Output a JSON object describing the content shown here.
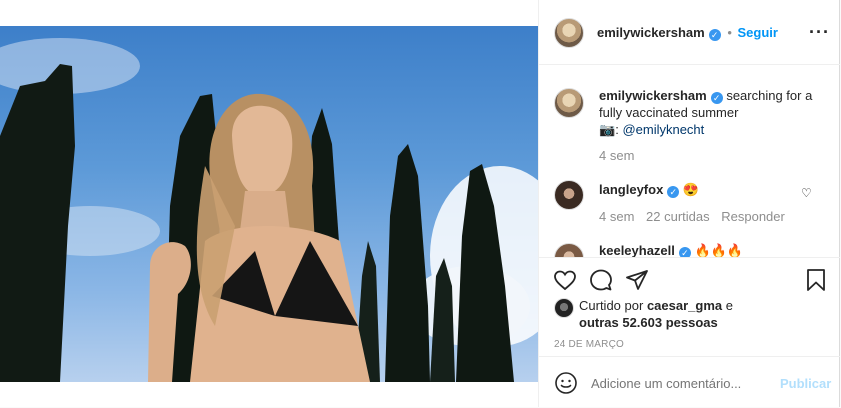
{
  "post": {
    "author": {
      "username": "emilywickersham",
      "follow_label": "Seguir",
      "dot": "•"
    },
    "more_icon": "more-horizontal-icon",
    "caption": {
      "username": "emilywickersham",
      "text": "searching for a fully vaccinated summer",
      "camera_icon": "camera-icon",
      "credit_sep": ":",
      "credit": "@emilyknecht",
      "time": "4 sem"
    },
    "comments": [
      {
        "username": "langleyfox",
        "emoji": "😍",
        "time": "4 sem",
        "likes": "22 curtidas",
        "reply_label": "Responder"
      },
      {
        "username": "keeleyhazell",
        "emoji": "🔥🔥🔥"
      }
    ],
    "likes": {
      "prefix": "Curtido por",
      "user": "caesar_gma",
      "connector": "e",
      "others": "outras 52.603 pessoas"
    },
    "date": "24 DE MARÇO",
    "add_comment": {
      "placeholder": "Adicione um comentário...",
      "publish_label": "Publicar"
    }
  },
  "colors": {
    "accent": "#0095f6",
    "verified": "#3897f0",
    "muted": "#8e8e8e",
    "publish_disabled": "#b2dffc"
  }
}
